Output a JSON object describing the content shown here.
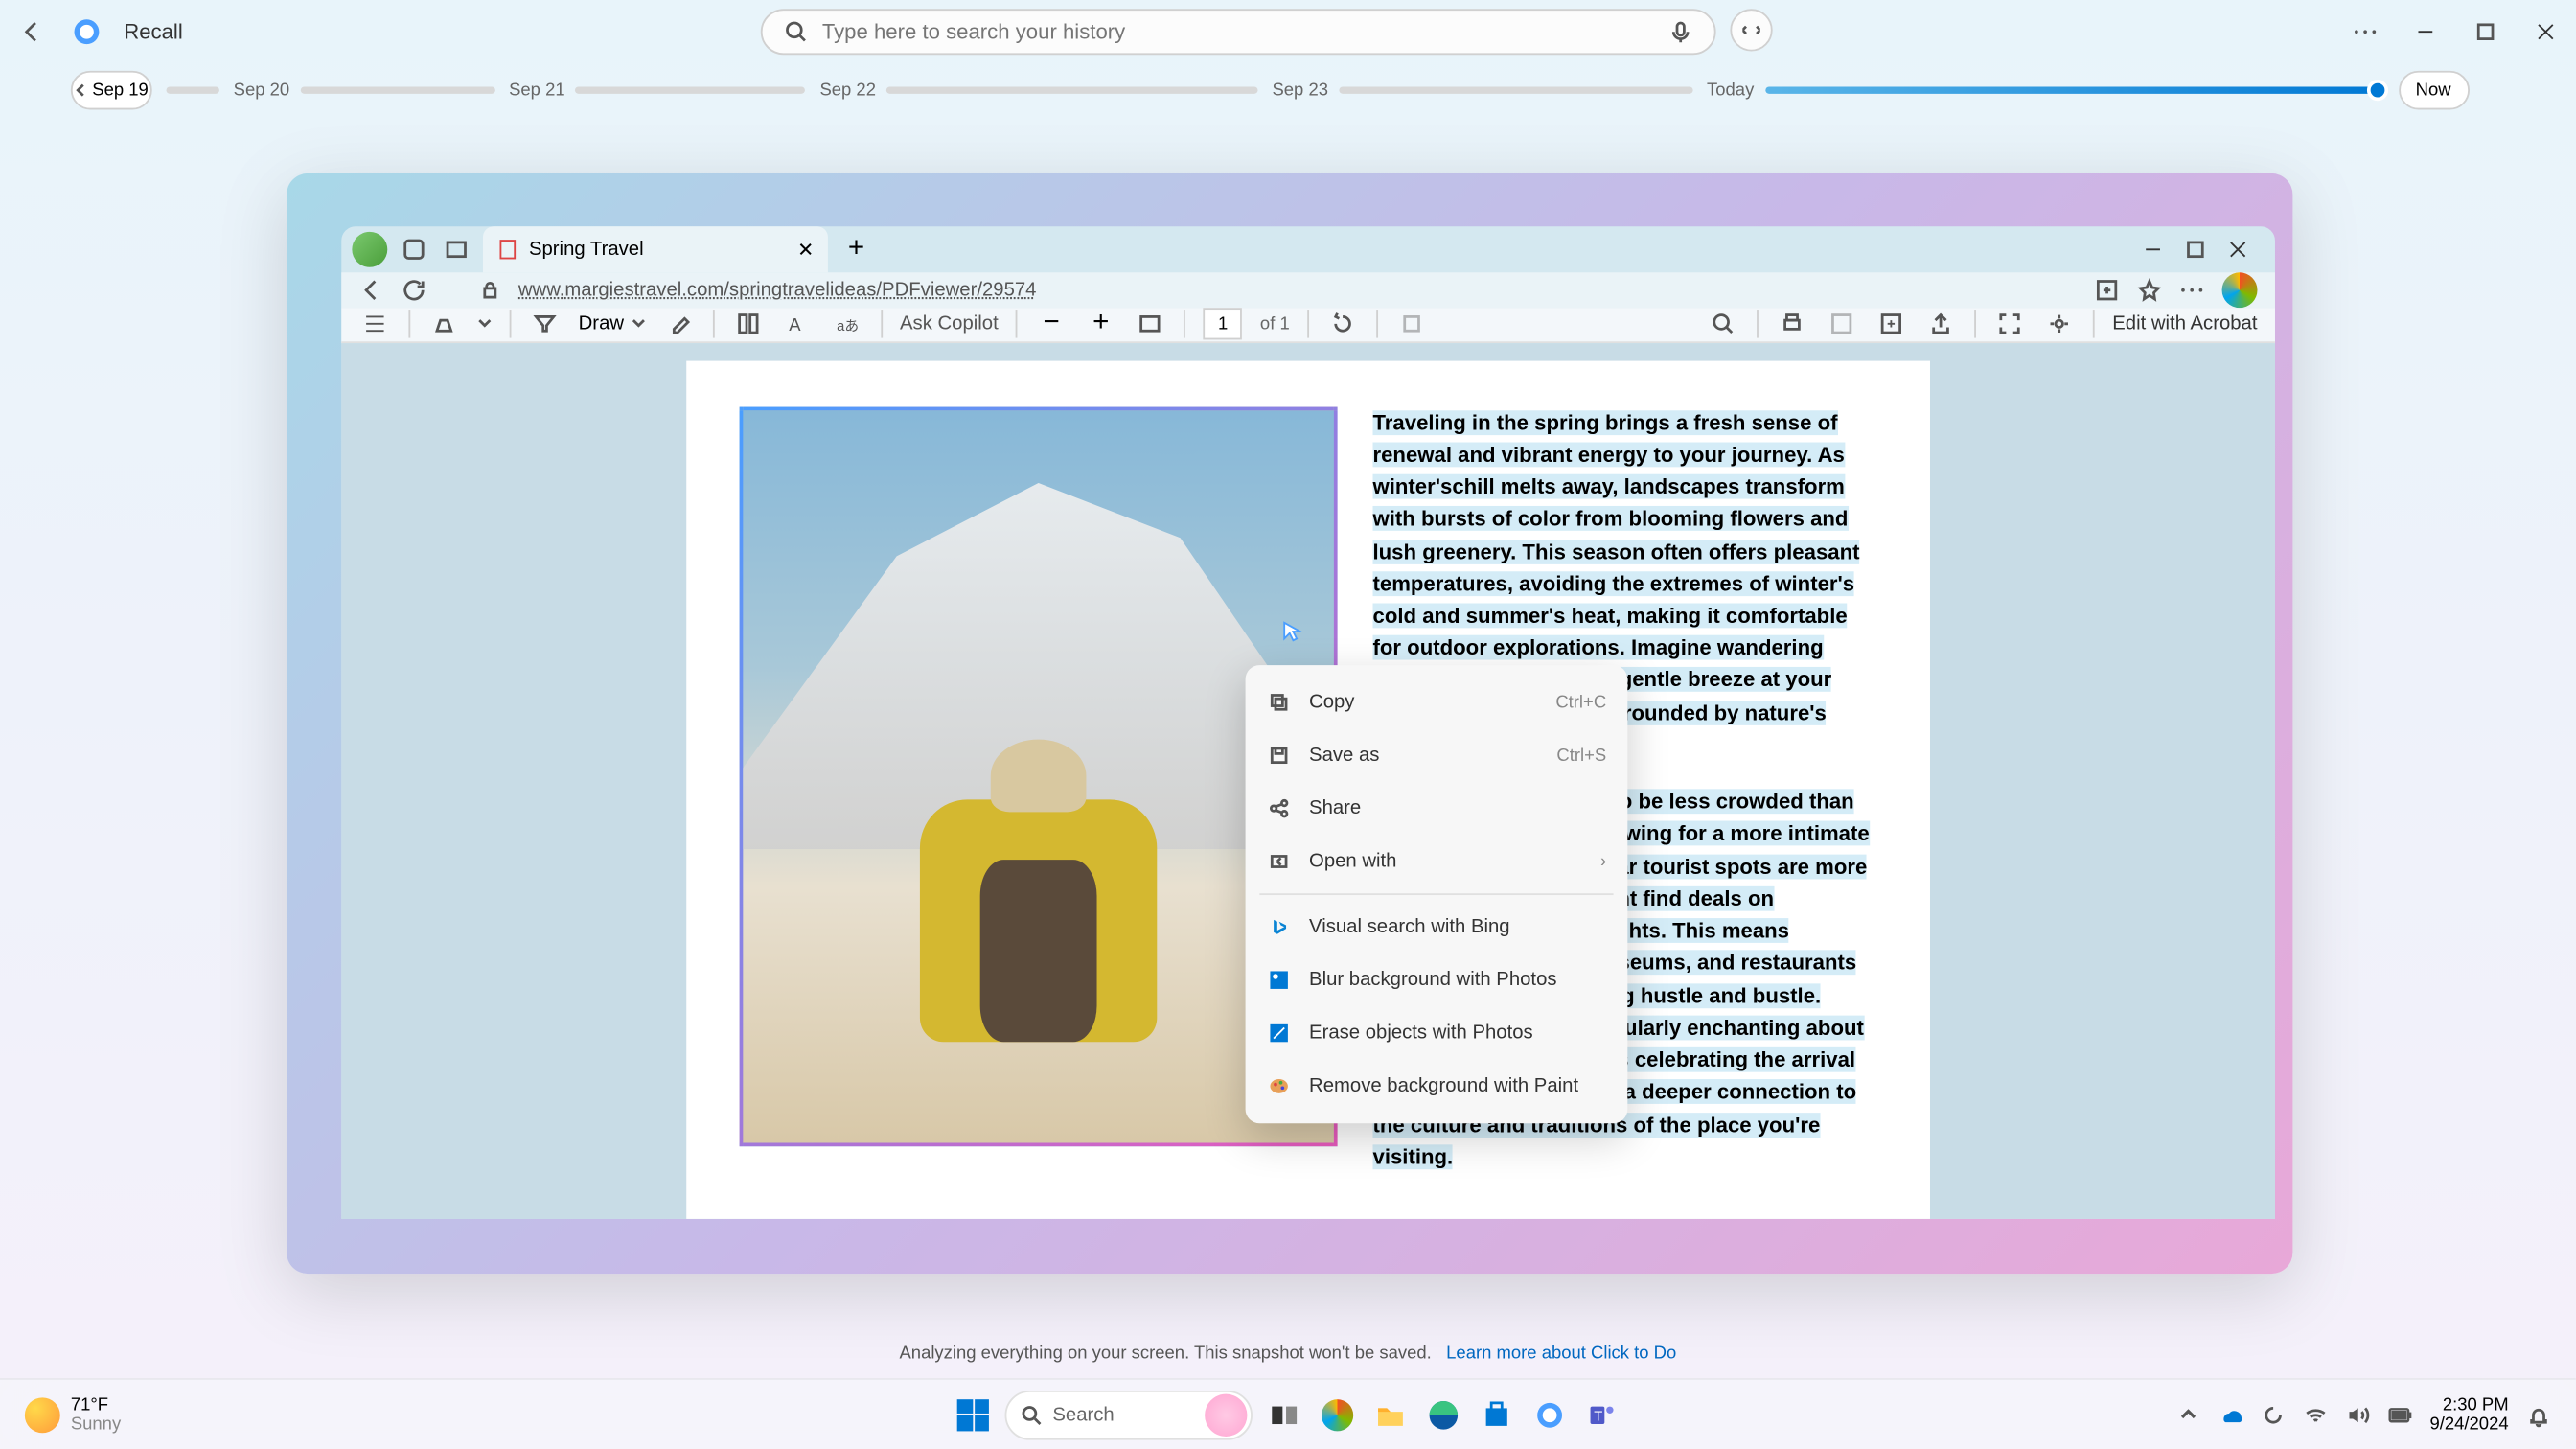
{
  "app": {
    "title": "Recall"
  },
  "search": {
    "placeholder": "Type here to search your history"
  },
  "timeline": {
    "nav_label": "Sep 19",
    "dates": [
      "Sep 20",
      "Sep 21",
      "Sep 22",
      "Sep 23"
    ],
    "today_label": "Today",
    "now_label": "Now"
  },
  "browser": {
    "tab_title": "Spring Travel",
    "url": "www.margiestravel.com/springtravelideas/PDFviewer/29574"
  },
  "pdf": {
    "draw_label": "Draw",
    "ask_copilot": "Ask Copilot",
    "page_current": "1",
    "page_of": "of 1",
    "edit_label": "Edit with Acrobat",
    "para1": "Traveling in the spring brings a fresh sense of renewal and vibrant energy to your journey. As winter'schill melts away, landscapes transform with bursts of color from blooming flowers and lush greenery. This season often offers pleasant temperatures, avoiding the extremes of winter's cold and summer's heat, making it comfortable for outdoor explorations. Imagine wandering through gardens, with a gentle breeze at your back, or hiking trail's surrounded by nature's revival.",
    "para2": "Moreover, spring tends to be less crowded than the summer months, allowing for a more intimate travel experience. Popular tourist spots are more accessible, and you might find deals on accommodations and flights. This means enjoying attractions, museums, and restaurants without the overwhelming hustle and bustle. There's something particularly enchanting about local festivals and events celebrating the arrival of spring, which provide a deeper connection to the culture and traditions of the place you're visiting."
  },
  "context_menu": {
    "copy": "Copy",
    "copy_shortcut": "Ctrl+C",
    "save_as": "Save as",
    "save_shortcut": "Ctrl+S",
    "share": "Share",
    "open_with": "Open with",
    "visual_search": "Visual search with Bing",
    "blur": "Blur background with Photos",
    "erase": "Erase objects with Photos",
    "remove_bg": "Remove background with Paint"
  },
  "notice": {
    "text": "Analyzing everything on your screen. This snapshot won't be saved.",
    "link": "Learn more about Click to Do"
  },
  "taskbar": {
    "weather_temp": "71°F",
    "weather_cond": "Sunny",
    "search_placeholder": "Search",
    "time": "2:30 PM",
    "date": "9/24/2024"
  }
}
